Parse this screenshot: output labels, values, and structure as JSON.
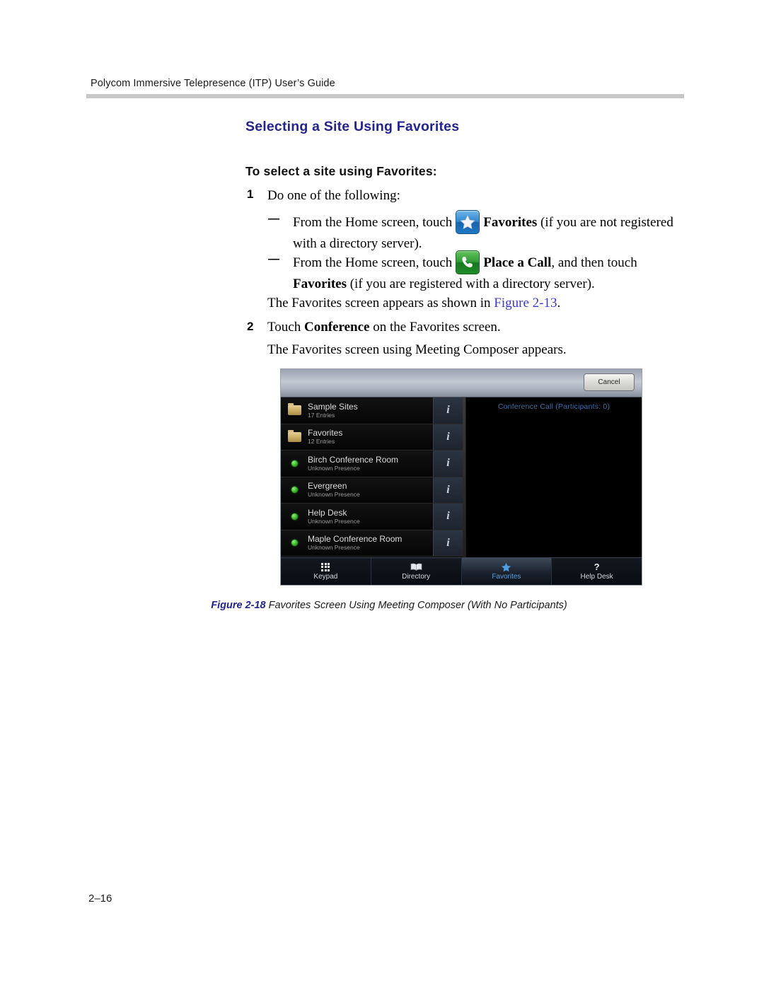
{
  "header": {
    "running_head": "Polycom Immersive Telepresence (ITP) User’s Guide"
  },
  "headings": {
    "section_title": "Selecting a Site Using Favorites",
    "procedure_title": "To select a site using Favorites:"
  },
  "steps": {
    "step1_num": "1",
    "step1_text": "Do one of the following:",
    "bullet_dash": "—",
    "bullet1_pre": "From the Home screen, touch",
    "bullet1_bold": "Favorites",
    "bullet1_post": "(if you are not registered with a directory server).",
    "bullet2_pre": "From the Home screen, touch",
    "bullet2_bold": "Place a Call",
    "bullet2_mid": ", and then touch",
    "bullet2_bold2": "Favorites",
    "bullet2_post": "(if you are registered with a directory server).",
    "result1_pre": "The Favorites screen appears as shown in",
    "result1_link": "Figure 2-13",
    "result1_post": ".",
    "step2_num": "2",
    "step2_pre": "Touch",
    "step2_bold": "Conference",
    "step2_post": "on the Favorites screen.",
    "result2": "The Favorites screen using Meeting Composer appears."
  },
  "figure": {
    "caption_number": "Figure 2-18",
    "caption_text": "Favorites Screen Using Meeting Composer (With No Participants)",
    "device": {
      "cancel_label": "Cancel",
      "detail_title": "Conference Call (Participants: 0)",
      "info_glyph": "i",
      "list": [
        {
          "marker": "folder-icon",
          "title": "Sample Sites",
          "subtitle": "17 Entries"
        },
        {
          "marker": "folder-icon",
          "title": "Favorites",
          "subtitle": "12 Entries"
        },
        {
          "marker": "presence-dot-icon",
          "title": "Birch Conference Room",
          "subtitle": "Unknown Presence"
        },
        {
          "marker": "presence-dot-icon",
          "title": "Evergreen",
          "subtitle": "Unknown Presence"
        },
        {
          "marker": "presence-dot-icon",
          "title": "Help Desk",
          "subtitle": "Unknown Presence"
        },
        {
          "marker": "presence-dot-icon",
          "title": "Maple Conference Room",
          "subtitle": "Unknown Presence"
        }
      ],
      "tabs": [
        {
          "label": "Keypad",
          "icon": "keypad-icon",
          "active": false
        },
        {
          "label": "Directory",
          "icon": "book-icon",
          "active": false
        },
        {
          "label": "Favorites",
          "icon": "star-icon",
          "active": true
        },
        {
          "label": "Help Desk",
          "icon": "question-mark-icon",
          "active": false
        }
      ]
    }
  },
  "footer": {
    "page_number": "2–16"
  },
  "colors": {
    "heading_blue": "#24248f",
    "link_blue": "#3a3ad6",
    "tab_active_blue": "#5b9bd5",
    "detail_title_blue": "#3f6ea8",
    "rule_grey": "#c6c6c6"
  }
}
